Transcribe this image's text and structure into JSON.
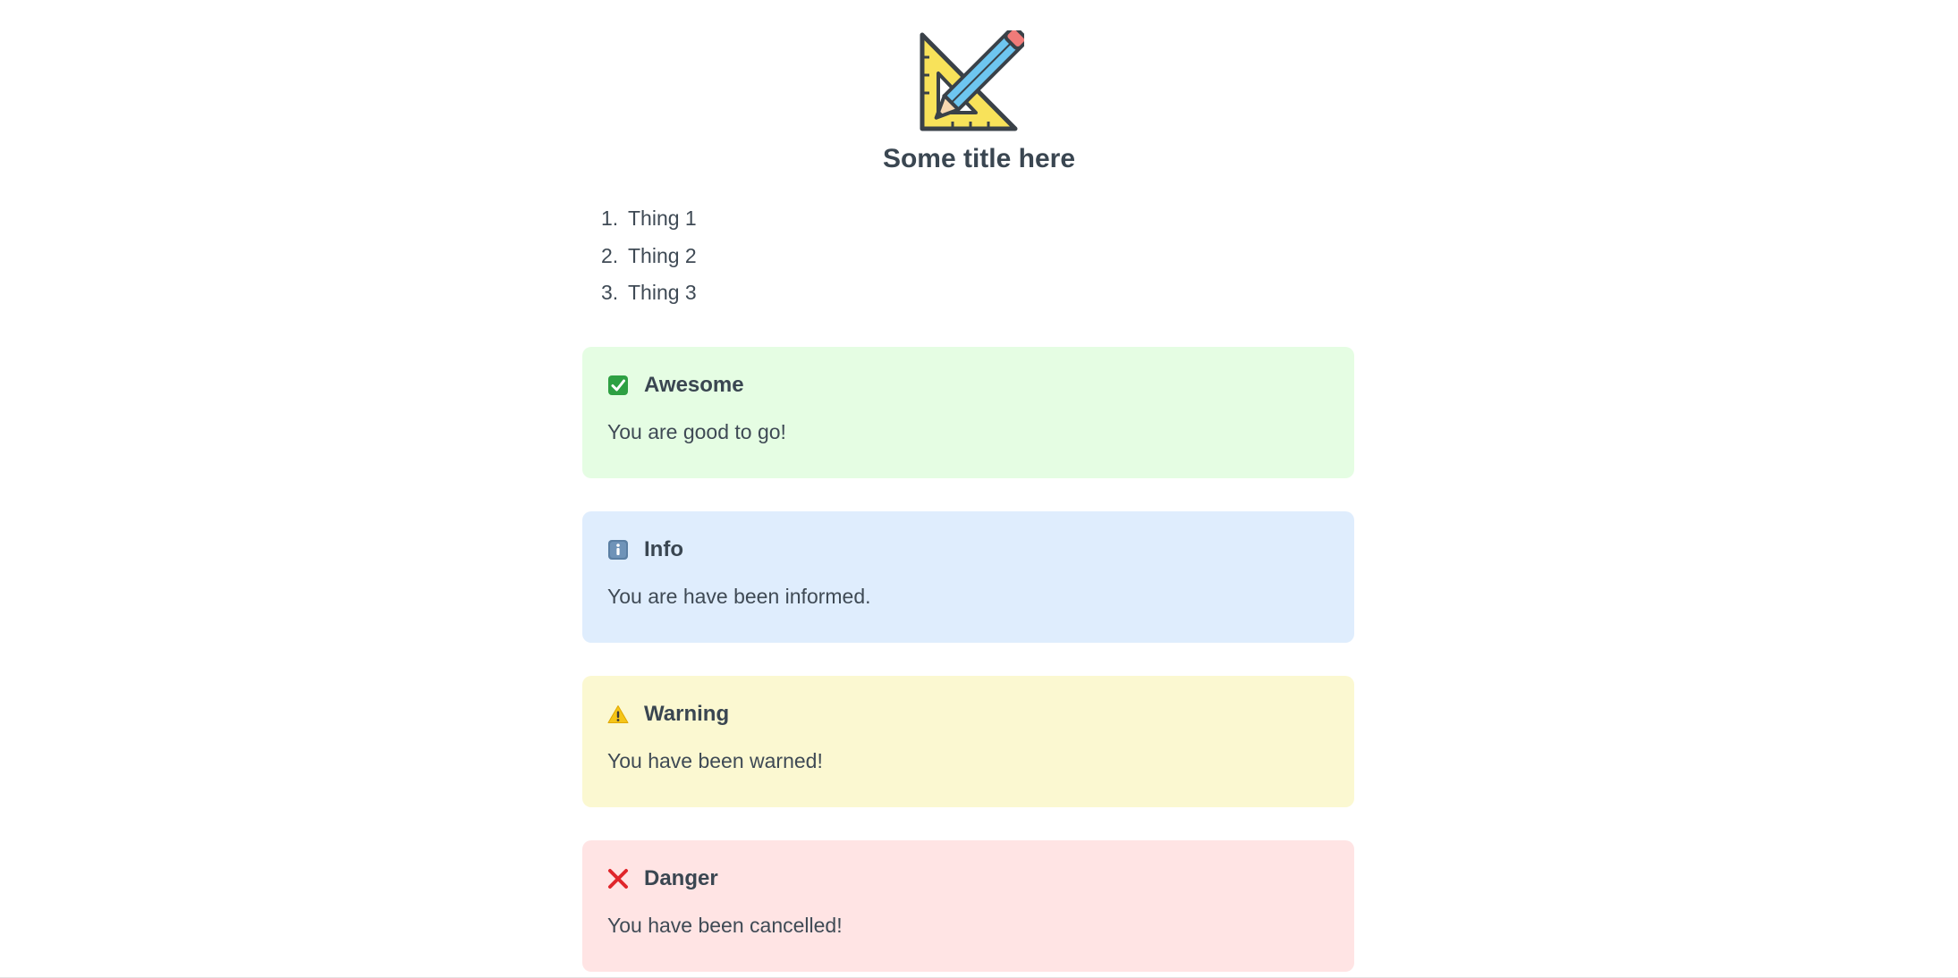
{
  "header": {
    "logo_icon": "set-square-pencil-icon",
    "title": "Some title here"
  },
  "list": {
    "items": [
      {
        "number": "1.",
        "label": "Thing 1"
      },
      {
        "number": "2.",
        "label": "Thing 2"
      },
      {
        "number": "3.",
        "label": "Thing 3"
      }
    ]
  },
  "callouts": {
    "success": {
      "icon": "check-box-icon",
      "title": "Awesome",
      "text": "You are good to go!",
      "color": "#e5fde3"
    },
    "info": {
      "icon": "info-icon",
      "title": "Info",
      "text": "You are have been informed.",
      "color": "#dfedfd"
    },
    "warning": {
      "icon": "warning-icon",
      "title": "Warning",
      "text": "You have been warned!",
      "color": "#fbf8d1"
    },
    "danger": {
      "icon": "cross-icon",
      "title": "Danger",
      "text": "You have been cancelled!",
      "color": "#ffe4e4"
    }
  }
}
